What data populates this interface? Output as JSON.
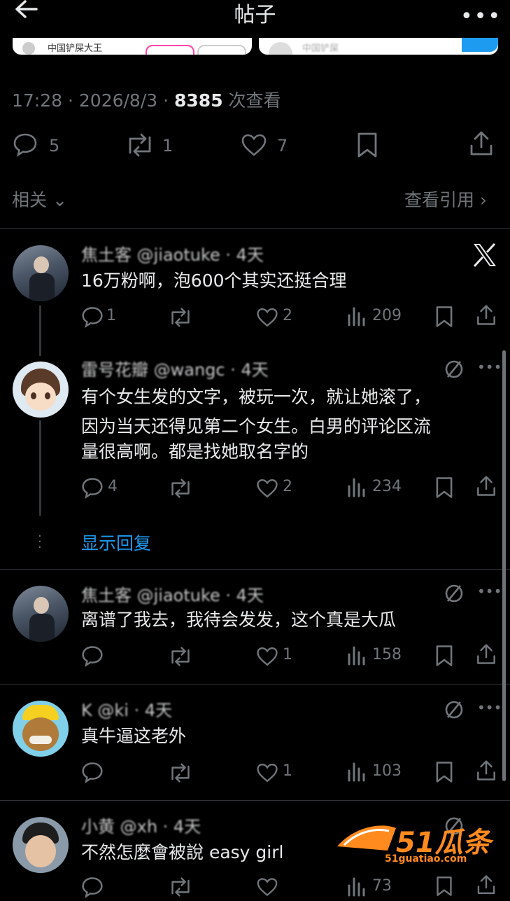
{
  "header": {
    "title": "帖子"
  },
  "post": {
    "time": "17:28 · 2026/8/3 · ",
    "views": "8385",
    "views_suffix": " 次查看",
    "replies": "5",
    "reposts": "1",
    "likes": "7"
  },
  "related": {
    "label": "相关",
    "quotes_label": "查看引用"
  },
  "replies": [
    {
      "handle_line": "焦土客 @jiaotuke · 4天",
      "text": [
        "16万粉啊，泡600个其实还挺合理"
      ],
      "comments": "1",
      "likes": "2",
      "views": "209"
    },
    {
      "handle_line": "雷号花瓣 @wangc · 4天",
      "text": [
        "有个女生发的文字，被玩一次，就让她滚了，",
        "因为当天还得见第二个女生。白男的评论区流",
        "量很高啊。都是找她取名字的"
      ],
      "comments": "4",
      "likes": "2",
      "views": "234"
    },
    {
      "handle_line": "焦土客 @jiaotuke · 4天",
      "text": [
        "离谱了我去，我待会发发，这个真是大瓜"
      ],
      "comments": "",
      "likes": "1",
      "views": "158"
    },
    {
      "handle_line": "K @ki · 4天",
      "text": [
        "真牛逼这老外"
      ],
      "comments": "",
      "likes": "1",
      "views": "103"
    },
    {
      "handle_line": "小黄 @xh · 4天",
      "text": [
        "不然怎麼會被說 easy girl"
      ],
      "comments": "",
      "likes": "",
      "views": "73"
    }
  ],
  "show_replies": "显示回复",
  "preview_cards": [
    "中国铲屎大王",
    "中国铲屎"
  ],
  "watermark": {
    "brand": "51瓜条",
    "url": "51guatiao.com"
  },
  "colors": {
    "accent": "#1d9bf0",
    "muted": "#71767b",
    "bg": "#000000"
  }
}
